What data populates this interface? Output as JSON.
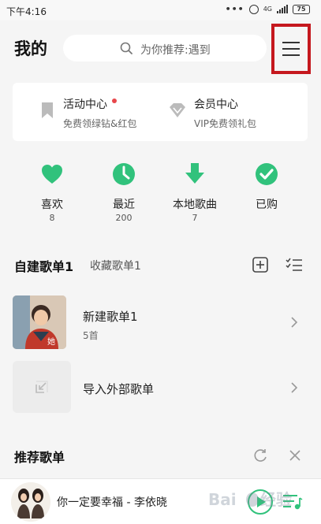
{
  "status_bar": {
    "time": "下午4:16",
    "dots": "•••",
    "network": "4G",
    "battery": "75"
  },
  "header": {
    "title": "我的",
    "search_placeholder": "为你推荐:遇到"
  },
  "card": {
    "activity": {
      "title": "活动中心",
      "subtitle": "免费领绿钻&红包"
    },
    "vip": {
      "title": "会员中心",
      "subtitle": "VIP免费领礼包"
    }
  },
  "quick": [
    {
      "label": "喜欢",
      "count": "8"
    },
    {
      "label": "最近",
      "count": "200"
    },
    {
      "label": "本地歌曲",
      "count": "7"
    },
    {
      "label": "已购",
      "count": ""
    }
  ],
  "tabs": {
    "self_built": "自建歌单1",
    "collected": "收藏歌单1"
  },
  "playlists": [
    {
      "name": "新建歌单1",
      "count": "5首"
    },
    {
      "name": "导入外部歌单"
    }
  ],
  "recommend": {
    "title": "推荐歌单"
  },
  "player": {
    "now_playing": "你一定要幸福 - 李依晓"
  },
  "colors": {
    "accent": "#31c27c",
    "highlight_border": "#c5181e",
    "red_dot": "#e8474b"
  }
}
